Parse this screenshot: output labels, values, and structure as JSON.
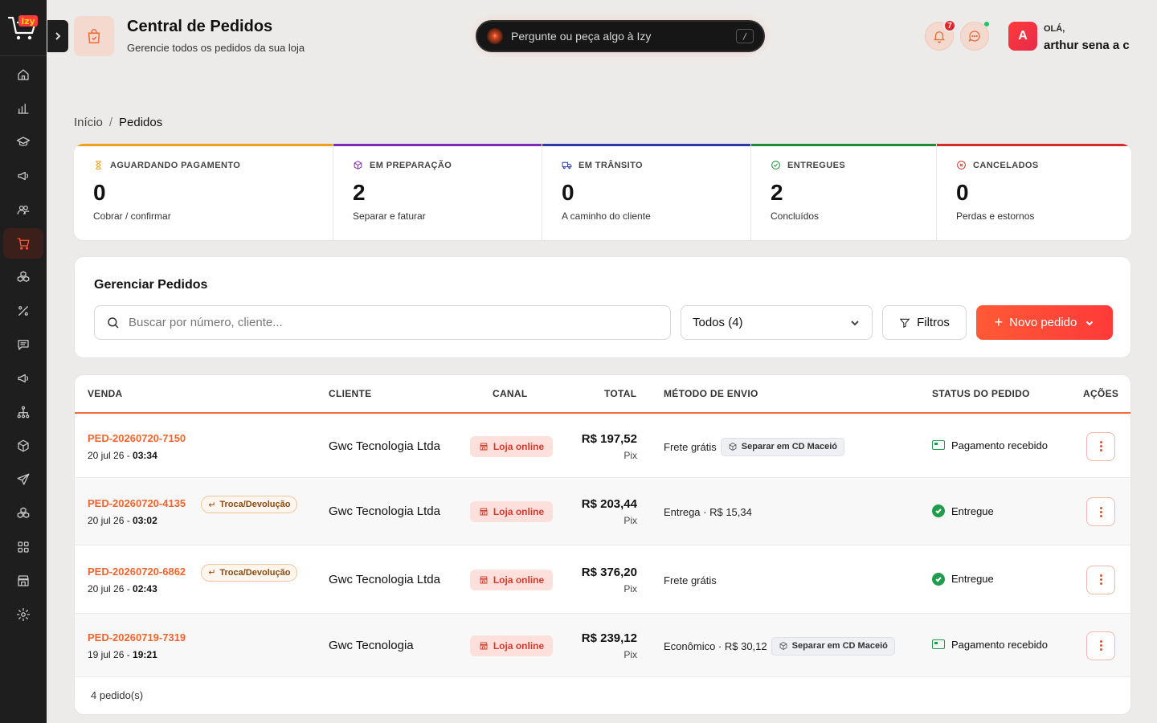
{
  "app": {
    "logo_text": "izy",
    "brand_color": "#ff5a36"
  },
  "sidebar": {
    "items": [
      {
        "icon": "home-icon"
      },
      {
        "icon": "bar-chart-icon"
      },
      {
        "icon": "graduation-cap-icon"
      },
      {
        "icon": "megaphone-icon"
      },
      {
        "icon": "users-icon"
      },
      {
        "icon": "shopping-cart-icon",
        "active": true
      },
      {
        "icon": "boxes-icon"
      },
      {
        "icon": "percent-icon"
      },
      {
        "icon": "message-square-icon"
      },
      {
        "icon": "megaphone-icon"
      },
      {
        "icon": "network-icon"
      },
      {
        "icon": "package-icon"
      },
      {
        "icon": "send-icon"
      },
      {
        "icon": "boxes-icon"
      },
      {
        "icon": "grid-icon"
      },
      {
        "icon": "store-icon"
      },
      {
        "icon": "settings-icon"
      }
    ]
  },
  "header": {
    "title": "Central de Pedidos",
    "subtitle": "Gerencie todos os pedidos da sua loja",
    "ai_placeholder": "Pergunte ou peça algo à Izy",
    "ai_shortcut": "/",
    "notifications_count": "7",
    "greeting": "OLÁ,",
    "user_name": "arthur sena a c",
    "user_initial": "A"
  },
  "breadcrumb": {
    "home": "Início",
    "separator": "/",
    "current": "Pedidos"
  },
  "stats": [
    {
      "label": "AGUARDANDO PAGAMENTO",
      "value": "0",
      "desc": "Cobrar / confirmar",
      "color": "#f0a11c",
      "icon": "hourglass-icon"
    },
    {
      "label": "EM PREPARAÇÃO",
      "value": "2",
      "desc": "Separar e faturar",
      "color": "#7b2bb8",
      "icon": "package-icon"
    },
    {
      "label": "EM TRÂNSITO",
      "value": "0",
      "desc": "A caminho do cliente",
      "color": "#2d3ba6",
      "icon": "truck-icon"
    },
    {
      "label": "ENTREGUES",
      "value": "2",
      "desc": "Concluídos",
      "color": "#1f8a3a",
      "icon": "check-circle-icon"
    },
    {
      "label": "CANCELADOS",
      "value": "0",
      "desc": "Perdas e estornos",
      "color": "#d42b2b",
      "icon": "x-circle-icon"
    }
  ],
  "manage": {
    "title": "Gerenciar Pedidos",
    "search_placeholder": "Buscar por número, cliente...",
    "select_value": "Todos (4)",
    "filters_label": "Filtros",
    "new_order_label": "Novo pedido"
  },
  "table": {
    "headers": {
      "sale": "VENDA",
      "client": "CLIENTE",
      "channel": "CANAL",
      "total": "TOTAL",
      "shipping": "MÉTODO DE ENVIO",
      "status": "STATUS DO PEDIDO",
      "actions": "AÇÕES"
    },
    "rows": [
      {
        "id": "PED-20260720-7150",
        "date": "20 jul 26 - ",
        "time": "03:34",
        "tag": "",
        "client": "Gwc Tecnologia Ltda",
        "channel": "Loja online",
        "total": "R$ 197,52",
        "payment": "Pix",
        "shipping": "Frete grátis",
        "cd": "Separar em CD Maceió",
        "status": "Pagamento recebido",
        "status_type": "paid"
      },
      {
        "id": "PED-20260720-4135",
        "date": "20 jul 26 - ",
        "time": "03:02",
        "tag": "Troca/Devolução",
        "client": "Gwc Tecnologia Ltda",
        "channel": "Loja online",
        "total": "R$ 203,44",
        "payment": "Pix",
        "shipping": "Entrega · R$ 15,34",
        "cd": "",
        "status": "Entregue",
        "status_type": "delivered"
      },
      {
        "id": "PED-20260720-6862",
        "date": "20 jul 26 - ",
        "time": "02:43",
        "tag": "Troca/Devolução",
        "client": "Gwc Tecnologia Ltda",
        "channel": "Loja online",
        "total": "R$ 376,20",
        "payment": "Pix",
        "shipping": "Frete grátis",
        "cd": "",
        "status": "Entregue",
        "status_type": "delivered"
      },
      {
        "id": "PED-20260719-7319",
        "date": "19 jul 26 - ",
        "time": "19:21",
        "tag": "",
        "client": "Gwc Tecnologia",
        "channel": "Loja online",
        "total": "R$ 239,12",
        "payment": "Pix",
        "shipping": "Econômico · R$ 30,12",
        "cd": "Separar em CD Maceió",
        "status": "Pagamento recebido",
        "status_type": "paid"
      }
    ],
    "footer": "4 pedido(s)"
  }
}
